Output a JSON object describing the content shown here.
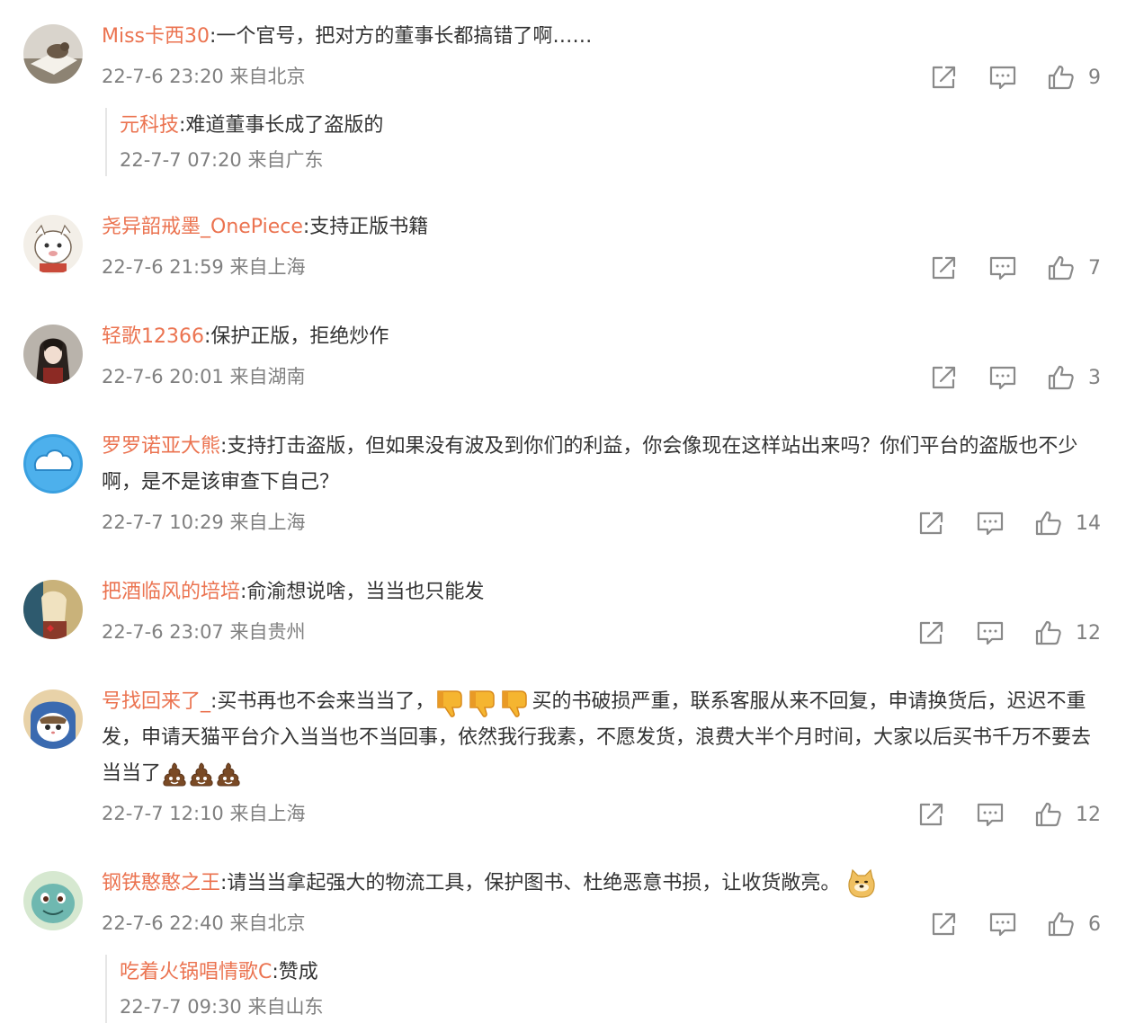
{
  "comments": [
    {
      "user": "Miss卡西30",
      "text": ":一个官号，把对方的董事长都搞错了啊……",
      "time": "22-7-6 23:20 来自北京",
      "likes": "9",
      "avatar": "cat-on-book-avatar",
      "reply": {
        "user": "元科技",
        "text": ":难道董事长成了盗版的",
        "time": "22-7-7 07:20 来自广东"
      }
    },
    {
      "user": "尧异韶戒墨_OnePiece",
      "text": ":支持正版书籍",
      "time": "22-7-6 21:59 来自上海",
      "likes": "7",
      "avatar": "cartoon-sheep-avatar"
    },
    {
      "user": "轻歌12366",
      "text": ":保护正版，拒绝炒作",
      "time": "22-7-6 20:01 来自湖南",
      "likes": "3",
      "avatar": "anime-character-avatar"
    },
    {
      "user": "罗罗诺亚大熊",
      "text": ":支持打击盗版，但如果没有波及到你们的利益，你会像现在这样站出来吗？你们平台的盗版也不少啊，是不是该审查下自己？",
      "time": "22-7-7 10:29 来自上海",
      "likes": "14",
      "avatar": "blue-cloud-avatar"
    },
    {
      "user": "把酒临风的培培",
      "text": ":俞渝想说啥，当当也只能发",
      "time": "22-7-6 23:07 来自贵州",
      "likes": "12",
      "avatar": "illustrated-character-avatar"
    },
    {
      "user": "号找回来了_",
      "text_a": ":买书再也不会来当当了，",
      "text_b": "买的书破损严重，联系客服从来不回复，申请换货后，迟迟不重发，申请天猫平台介入当当也不当回事，依然我行我素，不愿发货，浪费大半个月时间，大家以后买书千万不要去当当了",
      "time": "22-7-7 12:10 来自上海",
      "likes": "12",
      "avatar": "cat-in-hood-avatar"
    },
    {
      "user": "钢铁憨憨之王",
      "text": ":请当当拿起强大的物流工具，保护图书、杜绝恶意书损，让收货敞亮。",
      "time": "22-7-6 22:40 来自北京",
      "likes": "6",
      "avatar": "squirtle-avatar",
      "reply": {
        "user": "吃着火锅唱情歌C",
        "text": ":赞成",
        "time": "22-7-7 09:30 来自山东"
      }
    }
  ],
  "icons": {
    "share": "share-icon",
    "reply": "comment-icon",
    "like": "thumbs-up-icon",
    "emoji_thumbsdown": "thumbs-down-emoji",
    "emoji_poop": "poop-emoji",
    "emoji_doge": "doge-emoji"
  },
  "colors": {
    "username": "#eb7350",
    "text": "#333333",
    "meta": "#808080",
    "icon": "#8a8a8a"
  }
}
